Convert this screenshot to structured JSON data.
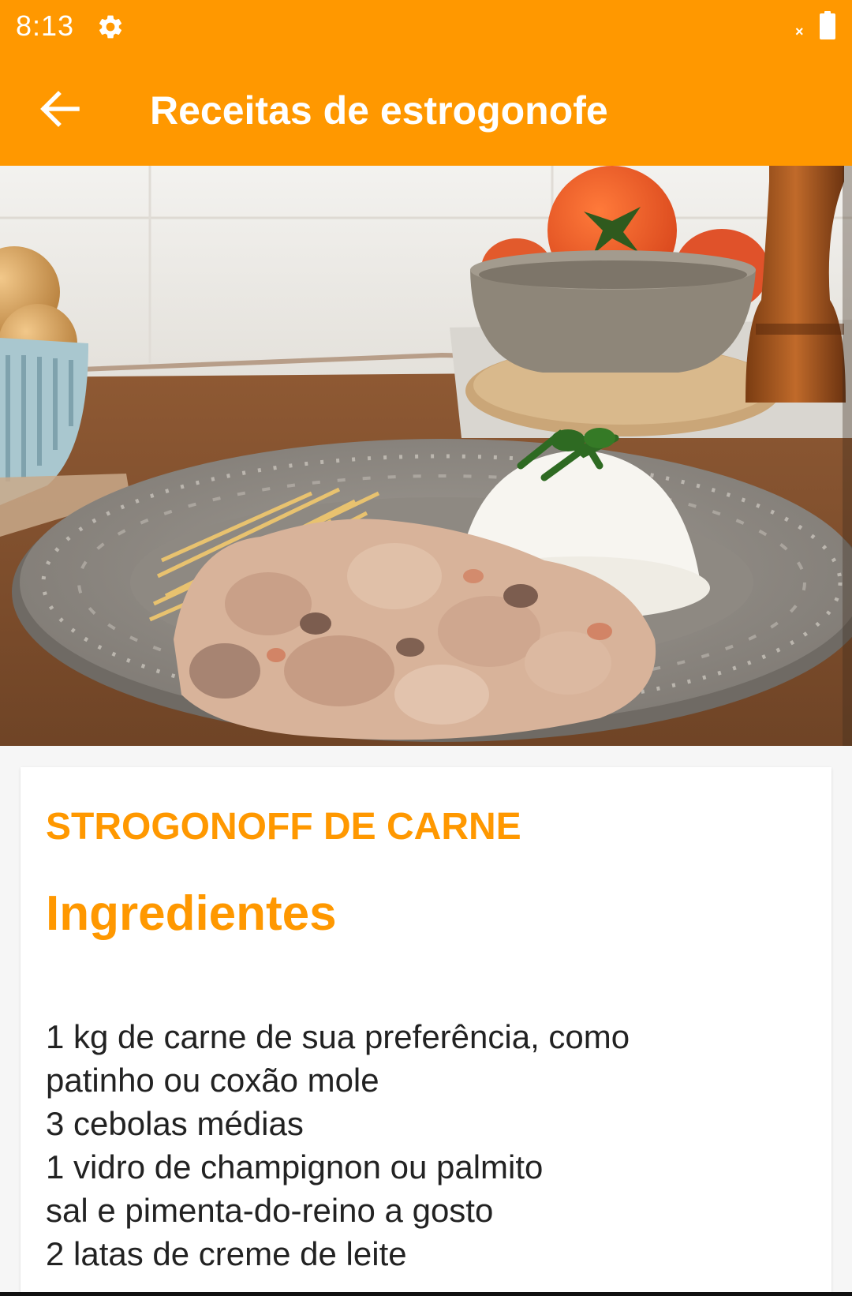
{
  "status_bar": {
    "time": "8:13",
    "icons": [
      "gear-icon",
      "no-signal-icon",
      "battery-icon"
    ],
    "no_signal_mark": "×"
  },
  "app_bar": {
    "title": "Receitas de estrogonofe",
    "back_icon": "arrow-left-icon"
  },
  "hero": {
    "icon": "food-photo"
  },
  "recipe": {
    "name": "STROGONOFF DE CARNE",
    "section_title": "Ingredientes",
    "ingredients": [
      "1 kg de carne de sua preferência, como",
      "patinho ou coxão mole",
      "3 cebolas médias",
      "1 vidro de champignon ou palmito",
      "sal e pimenta-do-reino a gosto",
      "2 latas de creme de leite"
    ]
  },
  "colors": {
    "accent": "#ff9800",
    "text": "#222222",
    "card": "#ffffff",
    "background": "#f6f6f6"
  }
}
